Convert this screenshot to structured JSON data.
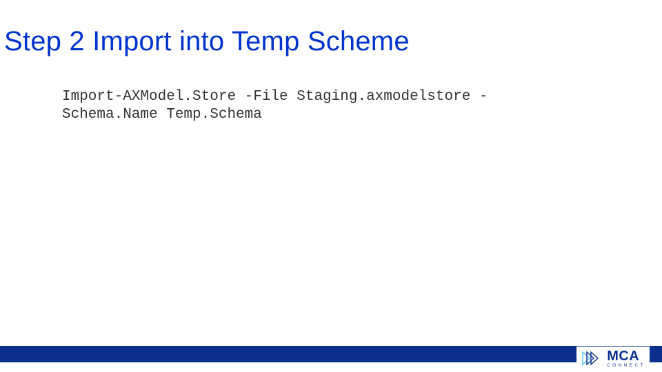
{
  "title": "Step 2 Import into Temp Scheme",
  "body": "Import-AXModel.Store -File Staging.axmodelstore -\nSchema.Name Temp.Schema",
  "logo": {
    "big": "MCA",
    "small": "CONNECT"
  },
  "colors": {
    "title": "#0033cc",
    "footer": "#0b2f8f",
    "accent": "#55c0f0"
  }
}
